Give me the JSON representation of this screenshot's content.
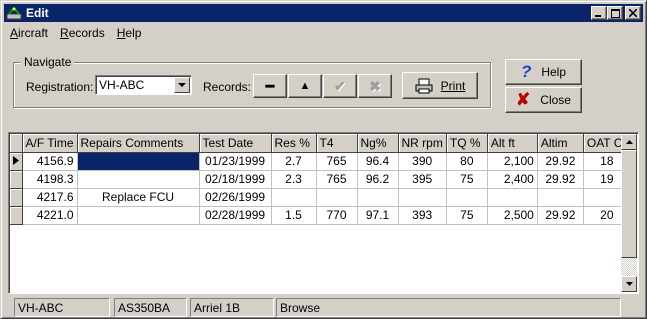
{
  "window": {
    "title": "Edit"
  },
  "menu": {
    "items": [
      {
        "label": "Aircraft",
        "mnemonic": "A"
      },
      {
        "label": "Records",
        "mnemonic": "R"
      },
      {
        "label": "Help",
        "mnemonic": "H"
      }
    ]
  },
  "navigate": {
    "legend": "Navigate",
    "registration_label": "Registration:",
    "registration_value": "VH-ABC",
    "records_label": "Records:",
    "buttons": [
      {
        "name": "delete-record-button",
        "icon": "minus-icon",
        "glyph": "━",
        "disabled": false
      },
      {
        "name": "insert-record-button",
        "icon": "triangle-up-icon",
        "glyph": "▲",
        "disabled": false
      },
      {
        "name": "post-record-button",
        "icon": "checkmark-icon",
        "glyph": "✔",
        "disabled": true
      },
      {
        "name": "cancel-record-button",
        "icon": "x-icon",
        "glyph": "✖",
        "disabled": true
      }
    ],
    "print_label": "Print"
  },
  "actions": {
    "help_label": "Help",
    "close_label": "Close"
  },
  "table": {
    "columns": [
      "A/F Time",
      "Repairs Comments",
      "Test Date",
      "Res %",
      "T4",
      "Ng%",
      "NR rpm",
      "TQ %",
      "Alt ft",
      "Altim",
      "OAT Cº"
    ],
    "rows": [
      {
        "current": true,
        "cells": [
          "4156.9",
          "",
          "01/23/1999",
          "2.7",
          "765",
          "96.4",
          "390",
          "80",
          "2,100",
          "29.92",
          "18"
        ]
      },
      {
        "current": false,
        "cells": [
          "4198.3",
          "",
          "02/18/1999",
          "2.3",
          "765",
          "96.2",
          "395",
          "75",
          "2,400",
          "29.92",
          "19"
        ]
      },
      {
        "current": false,
        "cells": [
          "4217.6",
          "Replace FCU",
          "02/26/1999",
          "",
          "",
          "",
          "",
          "",
          "",
          "",
          ""
        ]
      },
      {
        "current": false,
        "cells": [
          "4221.0",
          "",
          "02/28/1999",
          "1.5",
          "770",
          "97.1",
          "393",
          "75",
          "2,500",
          "29.92",
          "20"
        ]
      }
    ]
  },
  "status": {
    "registration": "VH-ABC",
    "model": "AS350BA",
    "engine": "Arriel 1B",
    "mode": "Browse"
  },
  "colors": {
    "title_bar": "#0a246a",
    "face": "#d4d0c8",
    "help_icon": "#1c3fcf",
    "close_icon": "#c00000"
  }
}
